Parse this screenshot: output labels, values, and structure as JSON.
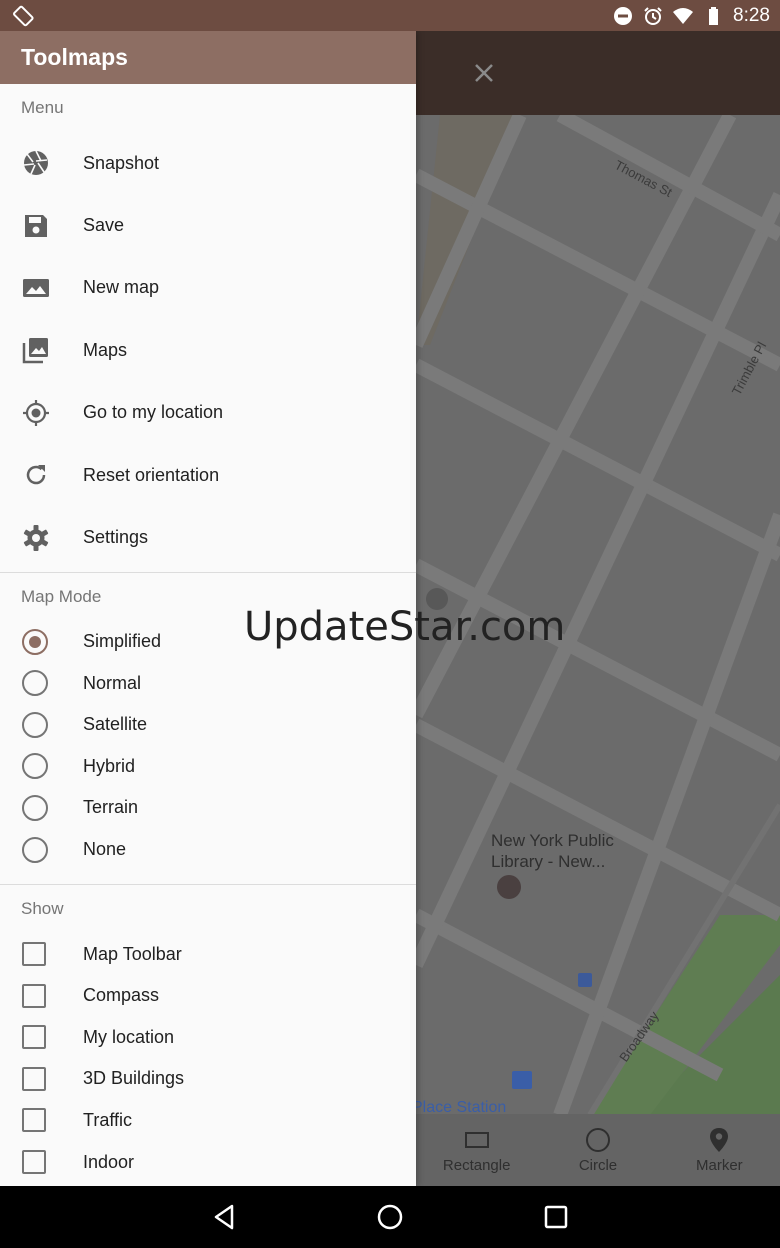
{
  "status_bar": {
    "time": "8:28",
    "icons": [
      "screen-rotation-icon",
      "do-not-disturb-icon",
      "alarm-icon",
      "wifi-icon",
      "battery-icon"
    ]
  },
  "drawer": {
    "title": "Toolmaps",
    "menu_section": {
      "title": "Menu",
      "items": [
        {
          "label": "Snapshot",
          "icon": "camera-aperture-icon"
        },
        {
          "label": "Save",
          "icon": "save-icon"
        },
        {
          "label": "New map",
          "icon": "image-icon"
        },
        {
          "label": "Maps",
          "icon": "photo-library-icon"
        },
        {
          "label": "Go to my location",
          "icon": "my-location-icon"
        },
        {
          "label": "Reset orientation",
          "icon": "refresh-icon"
        },
        {
          "label": "Settings",
          "icon": "gear-icon"
        }
      ]
    },
    "map_mode_section": {
      "title": "Map Mode",
      "selected": "Simplified",
      "options": [
        "Simplified",
        "Normal",
        "Satellite",
        "Hybrid",
        "Terrain",
        "None"
      ]
    },
    "show_section": {
      "title": "Show",
      "options": [
        "Map Toolbar",
        "Compass",
        "My location",
        "3D Buildings",
        "Traffic",
        "Indoor"
      ]
    }
  },
  "map": {
    "street_labels": [
      "Thomas St",
      "Trimble Pl",
      "Broadway"
    ],
    "poi_label": "New York Public Library - New...",
    "station_label": "Place Station",
    "tools": [
      {
        "label": "Rectangle",
        "icon": "rectangle-icon"
      },
      {
        "label": "Circle",
        "icon": "circle-icon"
      },
      {
        "label": "Marker",
        "icon": "map-marker-icon"
      }
    ]
  },
  "watermark": "UpdateStar.com",
  "colors": {
    "status_bar": "#6d4c41",
    "drawer_header": "#8d6e63",
    "accent": "#8d6e63",
    "map_topbar": "#3b2d28"
  }
}
